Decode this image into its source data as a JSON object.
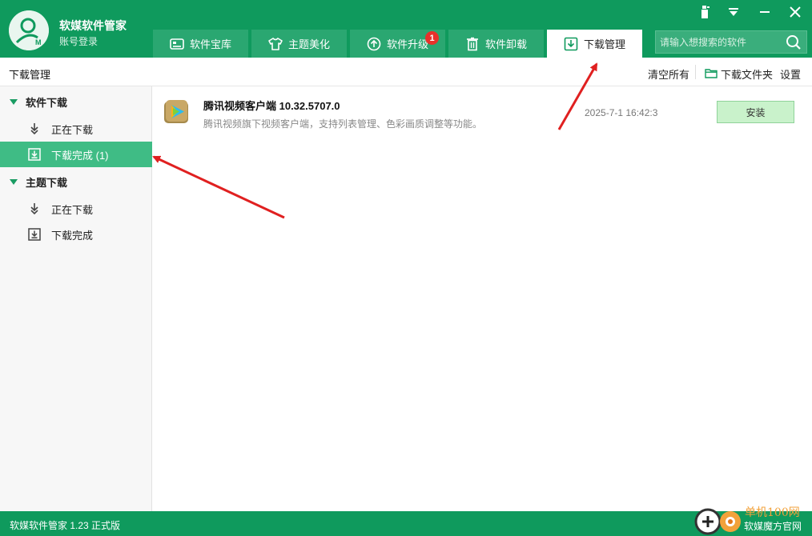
{
  "header": {
    "app_name": "软媒软件管家",
    "account_login": "账号登录",
    "tabs": [
      {
        "label": "软件宝库"
      },
      {
        "label": "主题美化"
      },
      {
        "label": "软件升级",
        "badge": "1"
      },
      {
        "label": "软件卸载"
      },
      {
        "label": "下载管理"
      }
    ],
    "search_placeholder": "请输入想搜索的软件"
  },
  "toolbar": {
    "page_title": "下载管理",
    "clear_all": "清空所有",
    "download_folder": "下载文件夹",
    "settings": "设置"
  },
  "sidebar": {
    "groups": [
      {
        "title": "软件下载",
        "items": [
          {
            "label": "正在下载"
          },
          {
            "label": "下载完成  (1)"
          }
        ]
      },
      {
        "title": "主题下载",
        "items": [
          {
            "label": "正在下载"
          },
          {
            "label": "下载完成"
          }
        ]
      }
    ]
  },
  "downloads": [
    {
      "name": "腾讯视频客户端 10.32.5707.0",
      "description": "腾讯视频旗下视频客户端，支持列表管理、色彩画质调整等功能。",
      "time": "2025-7-1 16:42:3",
      "action": "安装"
    }
  ],
  "status": {
    "version": "软媒软件管家 1.23 正式版"
  },
  "watermark": {
    "line1": "单机100网",
    "line2": "软媒魔方官网"
  },
  "colors": {
    "brand_green": "#0f9a5d",
    "active_item": "#3fbc85",
    "badge_red": "#e8312b",
    "annotation_red": "#e02020"
  }
}
